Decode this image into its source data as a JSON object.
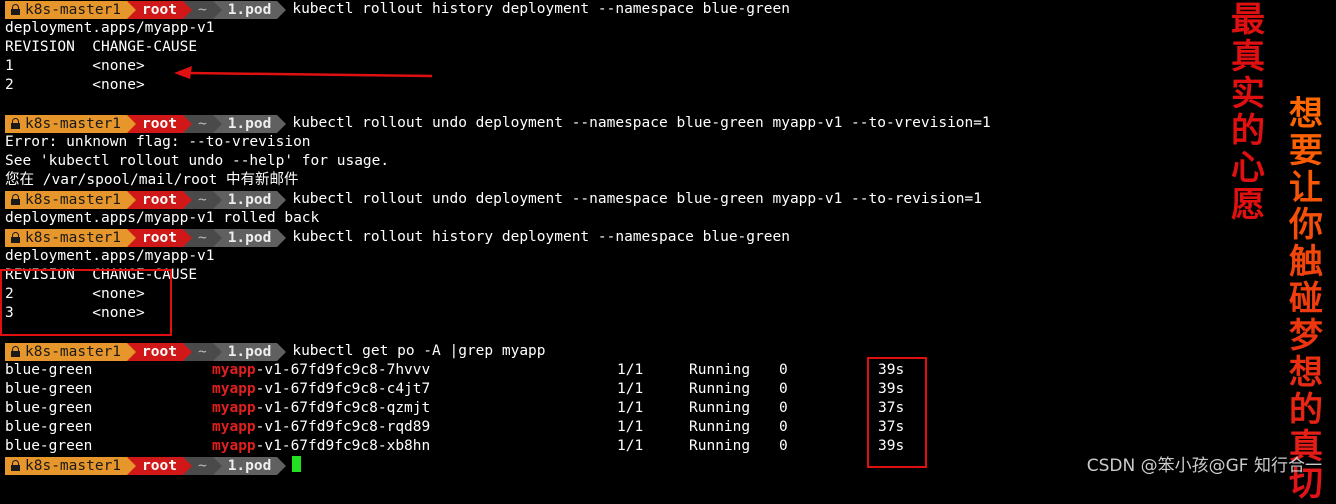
{
  "prompt": {
    "host": "k8s-master1",
    "user": "root",
    "dir_home": "~",
    "dir": "1.pod"
  },
  "lines": [
    {
      "type": "prompt",
      "cmd": "kubectl rollout history deployment --namespace blue-green"
    },
    {
      "type": "text",
      "text": "deployment.apps/myapp-v1"
    },
    {
      "type": "text",
      "text": "REVISION  CHANGE-CAUSE"
    },
    {
      "type": "text",
      "text": "1         <none>"
    },
    {
      "type": "text",
      "text": "2         <none>"
    },
    {
      "type": "blank"
    },
    {
      "type": "prompt",
      "cmd": "kubectl rollout undo deployment --namespace blue-green myapp-v1 --to-vrevision=1"
    },
    {
      "type": "text",
      "text": "Error: unknown flag: --to-vrevision"
    },
    {
      "type": "text",
      "text": "See 'kubectl rollout undo --help' for usage."
    },
    {
      "type": "text",
      "text": "您在 /var/spool/mail/root 中有新邮件"
    },
    {
      "type": "prompt",
      "cmd": "kubectl rollout undo deployment --namespace blue-green myapp-v1 --to-revision=1"
    },
    {
      "type": "text",
      "text": "deployment.apps/myapp-v1 rolled back"
    },
    {
      "type": "prompt",
      "cmd": "kubectl rollout history deployment --namespace blue-green"
    },
    {
      "type": "text",
      "text": "deployment.apps/myapp-v1"
    },
    {
      "type": "text",
      "text": "REVISION  CHANGE-CAUSE"
    },
    {
      "type": "text",
      "text": "2         <none>"
    },
    {
      "type": "text",
      "text": "3         <none>"
    },
    {
      "type": "blank"
    },
    {
      "type": "prompt",
      "cmd": "kubectl get po -A |grep myapp"
    },
    {
      "type": "pod",
      "ns": "blue-green",
      "hl": "myapp",
      "rest": "-v1-67fd9fc9c8-7hvvv",
      "ready": "1/1",
      "status": "Running",
      "restarts": "0",
      "age": "39s"
    },
    {
      "type": "pod",
      "ns": "blue-green",
      "hl": "myapp",
      "rest": "-v1-67fd9fc9c8-c4jt7",
      "ready": "1/1",
      "status": "Running",
      "restarts": "0",
      "age": "39s"
    },
    {
      "type": "pod",
      "ns": "blue-green",
      "hl": "myapp",
      "rest": "-v1-67fd9fc9c8-qzmjt",
      "ready": "1/1",
      "status": "Running",
      "restarts": "0",
      "age": "37s"
    },
    {
      "type": "pod",
      "ns": "blue-green",
      "hl": "myapp",
      "rest": "-v1-67fd9fc9c8-rqd89",
      "ready": "1/1",
      "status": "Running",
      "restarts": "0",
      "age": "37s"
    },
    {
      "type": "pod",
      "ns": "blue-green",
      "hl": "myapp",
      "rest": "-v1-67fd9fc9c8-xb8hn",
      "ready": "1/1",
      "status": "Running",
      "restarts": "0",
      "age": "39s"
    },
    {
      "type": "prompt",
      "cmd": "",
      "cursor": true
    }
  ],
  "annotations": {
    "text_red": "最真实的心愿",
    "text_orange": "想要让你触碰梦想的真切"
  },
  "watermark": "CSDN @笨小孩@GF 知行合一",
  "colors": {
    "host_bg": "#e6962a",
    "user_bg": "#d01818",
    "highlight": "#e0201e",
    "cursor": "#22e022",
    "annotation": "#e01010"
  }
}
